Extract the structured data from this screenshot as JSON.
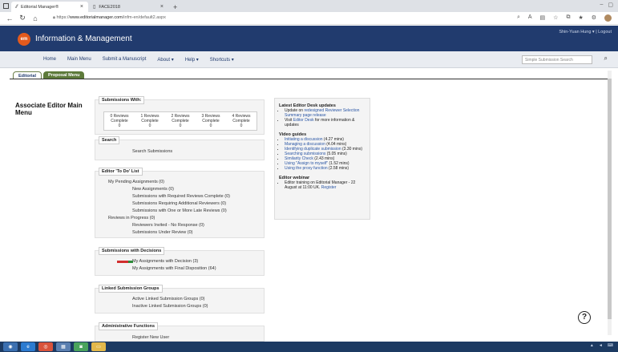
{
  "browser": {
    "tabs": [
      {
        "label": "Editorial Manager®",
        "active": true
      },
      {
        "label": "FACE2018",
        "active": false
      }
    ],
    "url_prefix": "https://",
    "url_domain": "www.editorialmanager.com",
    "url_path": "/infm-en/default2.aspx"
  },
  "header": {
    "logo_text": "em",
    "title": "Information & Management",
    "user_text": "Shin-Yuan Hung ▾ | Logout"
  },
  "nav": {
    "items": [
      "Home",
      "Main Menu",
      "Submit a Manuscript",
      "About ▾",
      "Help ▾",
      "Shortcuts ▾"
    ],
    "search_placeholder": "Simple Submission Search"
  },
  "page_tabs": {
    "editorial": "Editorial",
    "proposal": "Proposal Menu"
  },
  "menu_title": "Associate Editor Main Menu",
  "submissions_with": {
    "legend": "Submissions With:",
    "columns": [
      {
        "label1": "0 Reviews",
        "label2": "Complete",
        "count": "0"
      },
      {
        "label1": "1 Reviews",
        "label2": "Complete",
        "count": "0"
      },
      {
        "label1": "2 Reviews",
        "label2": "Complete",
        "count": "0"
      },
      {
        "label1": "3 Reviews",
        "label2": "Complete",
        "count": "0"
      },
      {
        "label1": "4 Reviews",
        "label2": "Complete",
        "count": "0"
      }
    ]
  },
  "search": {
    "legend": "Search",
    "link": "Search Submissions"
  },
  "todo": {
    "legend": "Editor 'To Do' List",
    "pending": "My Pending Assignments (0)",
    "items": [
      "New Assignments (0)",
      "Submissions with Required Reviews Complete (0)",
      "Submissions Requiring Additional Reviewers (0)",
      "Submissions with One or More Late Reviews (0)"
    ],
    "progress": "Reviews in Progress (0)",
    "progress_items": [
      "Reviewers Invited - No Response (0)",
      "Submissions Under Review (0)"
    ]
  },
  "decisions": {
    "legend": "Submissions with Decisions",
    "decision": "My Assignments with Decision (3)",
    "final": "My Assignments with Final Disposition (64)"
  },
  "linked": {
    "legend": "Linked Submission Groups",
    "active": "Active Linked Submission Groups (0)",
    "inactive": "Inactive Linked Submission Groups (0)"
  },
  "admin": {
    "legend": "Administrative Functions",
    "register": "Register New User"
  },
  "desk": {
    "updates_title": "Latest Editor Desk updates",
    "update1_prefix": "Update on ",
    "update1_link": "redesigned Reviewer Selection Summary page release",
    "update2_prefix": "Visit ",
    "update2_link": "Editor Desk",
    "update2_suffix": " for more information & updates",
    "videos_title": "Video guides",
    "videos": [
      {
        "link": "Initiating a discussion",
        "time": " (4.27 mins)"
      },
      {
        "link": "Managing a discussion",
        "time": " (4.04 mins)"
      },
      {
        "link": "Identifying duplicate submission",
        "time": " (3.30 mins)"
      },
      {
        "link": "Searching submissions",
        "time": " (5.05 mins)"
      },
      {
        "link": "Similarity Check",
        "time": " (2.43 mins)"
      },
      {
        "link": "Using \"Assign to myself\"",
        "time": " (1.52 mins)"
      },
      {
        "link": "Using the proxy function",
        "time": " (2.58 mins)"
      }
    ],
    "webinar_title": "Editor webinar",
    "webinar_text": "Editor training on Editorial Manager - 22 August at 11:00 UK. ",
    "webinar_link": "Register"
  },
  "help_glyph": "?"
}
